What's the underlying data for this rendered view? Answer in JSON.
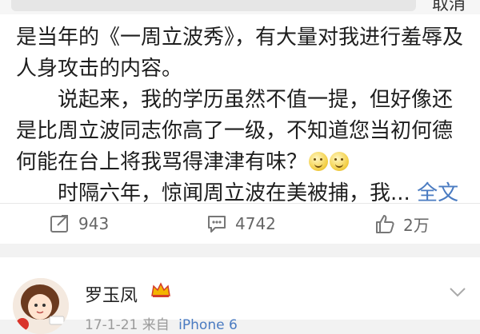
{
  "header": {
    "action_label": "取消"
  },
  "post": {
    "lines": [
      "是当年的《一周立波秀》，有大量对我进行羞辱及",
      "人身攻击的内容。"
    ],
    "paragraph2": "说起来，我的学历虽然不值一提，但好像还是比周立波同志你高了一级，不知道您当初何德何能在台上将我骂得津津有味？",
    "paragraph3": "时隔六年，惊闻周立波在美被捕，我...",
    "expand_label": "全文",
    "emoji_icons": [
      "smiley-icon",
      "smiley-icon"
    ]
  },
  "actions": {
    "repost_count": "943",
    "comment_count": "4742",
    "like_count": "2万"
  },
  "next_post": {
    "username": "罗玉凤",
    "badge_icon": "crown-icon",
    "time": "17-1-21",
    "source_prefix": "来自",
    "source": "iPhone 6"
  },
  "colors": {
    "link": "#4a7bc1",
    "muted": "#666666",
    "badge": "#f4b400"
  }
}
